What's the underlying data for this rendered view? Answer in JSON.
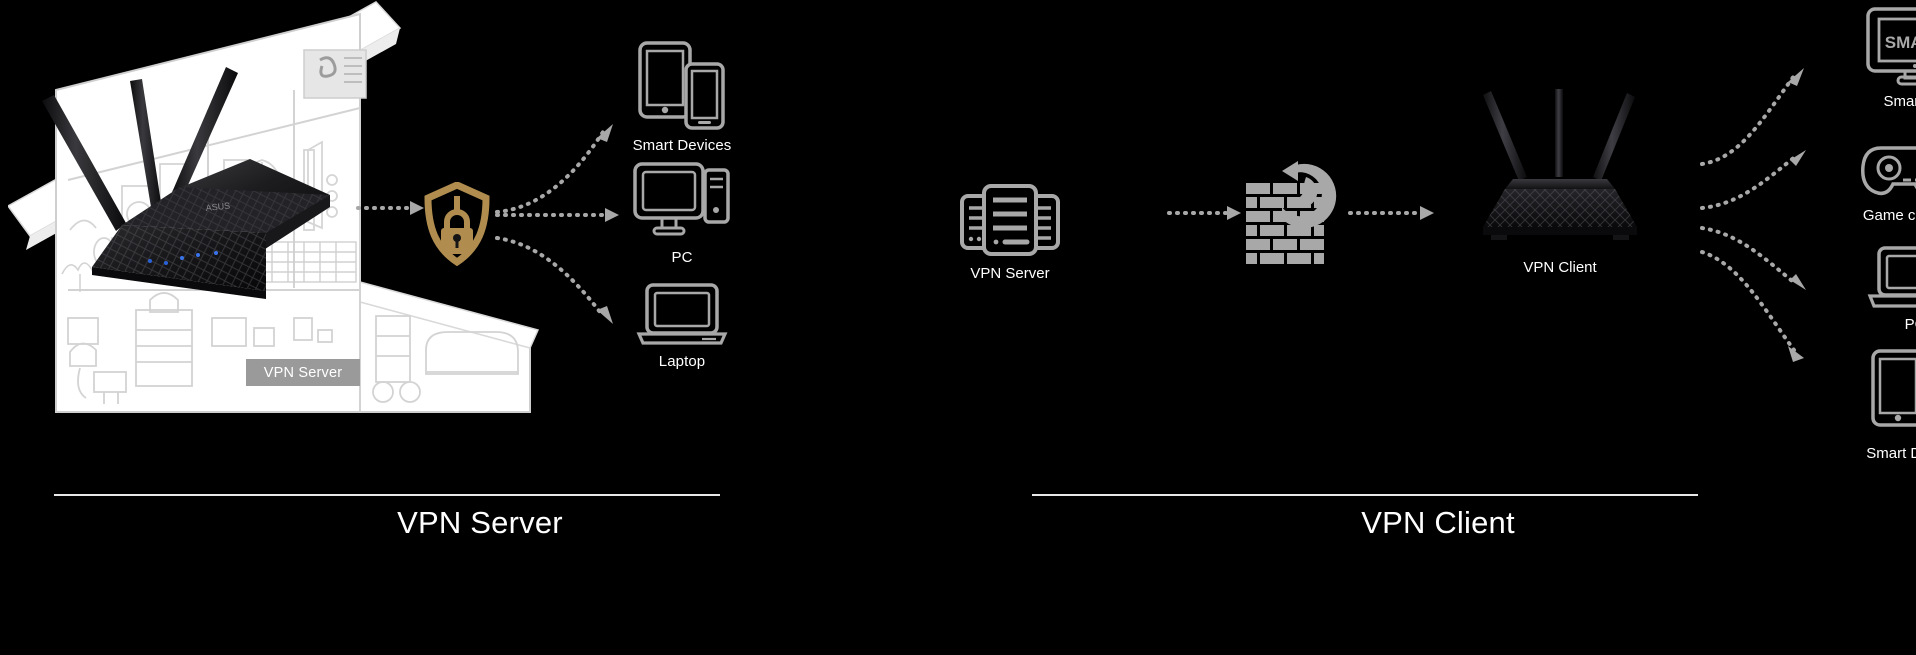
{
  "page": {
    "background": "#000000",
    "accent_gold": "#b08d4f",
    "icon_gray": "#a8a8a8",
    "text_color": "#ffffff"
  },
  "left_panel": {
    "caption": "VPN Server",
    "house_badge": "VPN Server",
    "router_brand": "ASUS",
    "shield_icon": "shield-lock-icon",
    "router_icon": "wifi-router-photo",
    "devices": [
      {
        "label": "Smart Devices",
        "icon": "tablet-and-phone-icon"
      },
      {
        "label": "PC",
        "icon": "desktop-computer-icon"
      },
      {
        "label": "Laptop",
        "icon": "laptop-icon"
      }
    ],
    "arrows": [
      {
        "name": "arrow-router-to-shield",
        "style": "straight"
      },
      {
        "name": "arrow-shield-to-smart-devices",
        "style": "curve-up"
      },
      {
        "name": "arrow-shield-to-pc",
        "style": "straight"
      },
      {
        "name": "arrow-shield-to-laptop",
        "style": "curve-down"
      }
    ]
  },
  "right_panel": {
    "caption": "VPN Client",
    "server_label": "VPN Server",
    "server_icon": "server-stack-icon",
    "firewall_icon": "brick-wall-globe-icon",
    "client_label": "VPN Client",
    "client_icon": "wifi-router-photo",
    "devices": [
      {
        "label": "Smart TV",
        "icon": "smart-tv-icon",
        "screen_text": "SMART"
      },
      {
        "label": "Game consoles",
        "icon": "game-controller-icon"
      },
      {
        "label": "PC",
        "icon": "laptop-icon"
      },
      {
        "label": "Smart Devices",
        "icon": "tablet-and-phone-icon"
      }
    ],
    "arrows": [
      {
        "name": "arrow-server-to-firewall",
        "style": "straight"
      },
      {
        "name": "arrow-firewall-to-client",
        "style": "straight"
      },
      {
        "name": "arrow-client-to-smart-tv",
        "style": "curve-up-steep"
      },
      {
        "name": "arrow-client-to-game-consoles",
        "style": "curve-up"
      },
      {
        "name": "arrow-client-to-pc",
        "style": "curve-down"
      },
      {
        "name": "arrow-client-to-smart-devices",
        "style": "curve-down-steep"
      }
    ]
  }
}
